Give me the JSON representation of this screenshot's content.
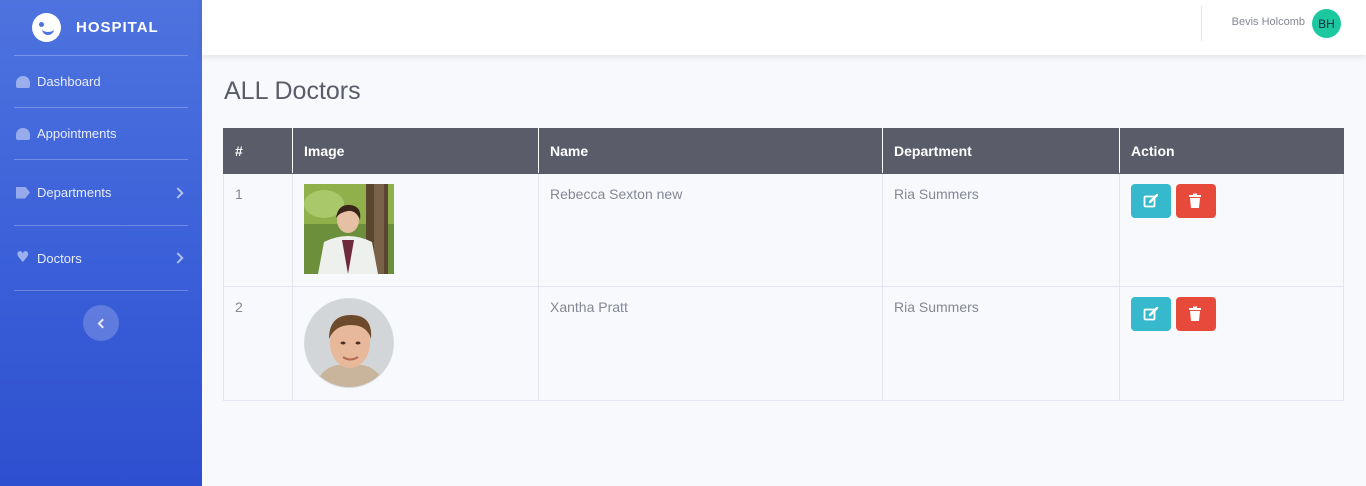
{
  "brand": {
    "name": "HOSPITAL"
  },
  "sidebar": {
    "items": [
      {
        "label": "Dashboard",
        "icon": "tachometer-icon"
      },
      {
        "label": "Appointments",
        "icon": "tachometer-icon"
      },
      {
        "label": "Departments",
        "icon": "tags-icon"
      },
      {
        "label": "Doctors",
        "icon": "heart-icon"
      }
    ]
  },
  "topbar": {
    "user_name": "Bevis Holcomb",
    "avatar_initials": "BH"
  },
  "page": {
    "title": "ALL Doctors"
  },
  "table": {
    "headers": [
      "#",
      "Image",
      "Name",
      "Department",
      "Action"
    ],
    "rows": [
      {
        "index": "1",
        "name": "Rebecca Sexton new",
        "department": "Ria Summers"
      },
      {
        "index": "2",
        "name": "Xantha Pratt",
        "department": "Ria Summers"
      }
    ]
  },
  "colors": {
    "sidebar": "#4e73df",
    "edit": "#36b9cc",
    "delete": "#e74a3b",
    "header": "#5a5c69",
    "avatar": "#1cc8a0"
  }
}
